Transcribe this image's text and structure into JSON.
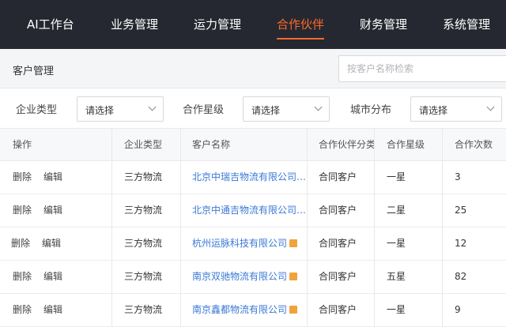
{
  "nav": {
    "items": [
      {
        "label": "AI工作台"
      },
      {
        "label": "业务管理"
      },
      {
        "label": "运力管理"
      },
      {
        "label": "合作伙伴"
      },
      {
        "label": "财务管理"
      },
      {
        "label": "系统管理"
      }
    ],
    "active_index": 3
  },
  "page": {
    "title": "客户管理",
    "search_placeholder": "按客户名称检索"
  },
  "filters": [
    {
      "label": "企业类型",
      "value": "请选择"
    },
    {
      "label": "合作星级",
      "value": "请选择"
    },
    {
      "label": "城市分布",
      "value": "请选择"
    }
  ],
  "table": {
    "headers": [
      "操作",
      "企业类型",
      "客户名称",
      "合作伙伴分类",
      "合作星级",
      "合作次数"
    ],
    "delete_label": "删除",
    "edit_label": "编辑",
    "rows": [
      {
        "type": "三方物流",
        "name": "北京中瑞吉物流有限公司…",
        "category": "合同客户",
        "stars": "一星",
        "count": "3"
      },
      {
        "type": "三方物流",
        "name": "北京中通吉物流有限公司…",
        "category": "合同客户",
        "stars": "二星",
        "count": "25"
      },
      {
        "type": "三方物流",
        "name": "杭州运脉科技有限公司",
        "category": "合同客户",
        "stars": "一星",
        "count": "12"
      },
      {
        "type": "三方物流",
        "name": "南京双驰物流有限公司",
        "category": "合同客户",
        "stars": "五星",
        "count": "82"
      },
      {
        "type": "三方物流",
        "name": "南京鑫都物流有限公司",
        "category": "合同客户",
        "stars": "一星",
        "count": "9"
      }
    ]
  },
  "colors": {
    "nav_bg": "#252830",
    "accent": "#ff6a2a",
    "link": "#3a78d6",
    "badge": "#f0a33a"
  }
}
